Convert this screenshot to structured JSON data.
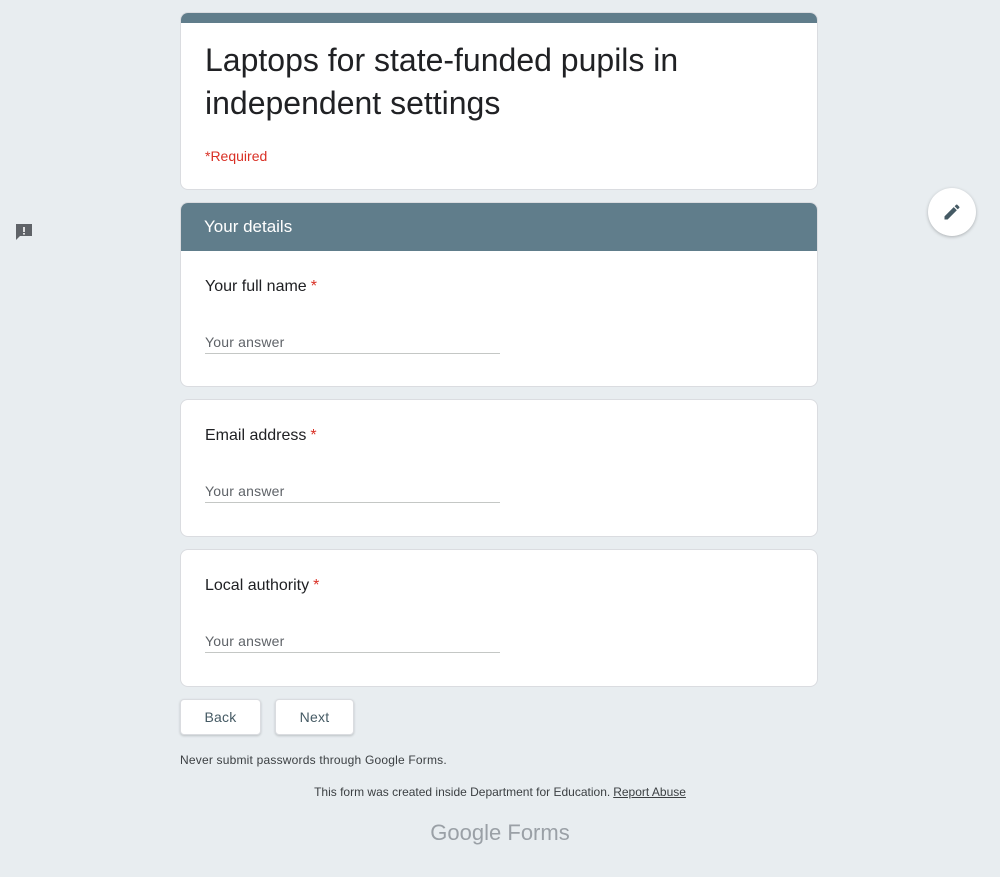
{
  "form": {
    "title": "Laptops for state-funded pupils in independent settings",
    "required_note": "*Required",
    "section_title": "Your details",
    "questions": [
      {
        "label": "Your full name",
        "required_mark": "*",
        "placeholder": "Your answer"
      },
      {
        "label": "Email address",
        "required_mark": "*",
        "placeholder": "Your answer"
      },
      {
        "label": "Local authority",
        "required_mark": "*",
        "placeholder": "Your answer"
      }
    ]
  },
  "buttons": {
    "back": "Back",
    "next": "Next"
  },
  "footer": {
    "warning": "Never submit passwords through Google Forms.",
    "created_by": "This form was created inside Department for Education.",
    "report_link": "Report Abuse",
    "brand_google": "Google",
    "brand_forms": "Forms"
  },
  "icons": {
    "feedback": "feedback-icon",
    "edit": "pencil-icon"
  },
  "colors": {
    "accent": "#607d8b",
    "required": "#d93025",
    "background": "#e8edf0"
  }
}
